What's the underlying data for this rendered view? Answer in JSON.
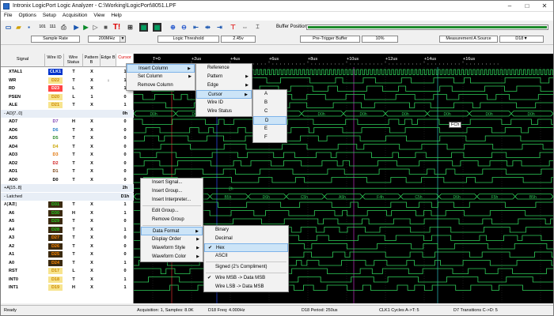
{
  "window": {
    "title": "Intronix LogicPort Logic Analyzer - C:\\Working\\LogicPort\\8051.LPF"
  },
  "menu": [
    "File",
    "Options",
    "Setup",
    "Acquisition",
    "View",
    "Help"
  ],
  "buffer": {
    "label": "Buffer Position:"
  },
  "toolbar2": {
    "sample_rate_label": "Sample Rate",
    "sample_rate": "200MHz",
    "threshold_label": "Logic Threshold",
    "threshold": "2.45v",
    "pretrigger_label": "Pre-Trigger Buffer",
    "pretrigger": "10%",
    "measurement_label": "Measurement A Source",
    "measurement": "D18"
  },
  "columns": {
    "signal": "Signal",
    "wire_id": "Wire ID",
    "wire_status": "Wire Status",
    "pattern": "Pattern B",
    "edge": "Edge B",
    "cursor": "Cursor"
  },
  "time_labels": [
    "T=0",
    "+2us",
    "+4us",
    "+6us",
    "+8us",
    "+10us",
    "+12us",
    "+14us",
    "+16us"
  ],
  "rows": [
    {
      "name": "XTAL1",
      "wire": "CLK1",
      "status": "T",
      "pattern": "X",
      "edge": "",
      "cursor": "1",
      "wcolor": "#0033cc",
      "tcolor": "#fff"
    },
    {
      "name": "WR",
      "wire": "D22",
      "status": "T",
      "pattern": "X",
      "edge": "↓",
      "cursor": "1",
      "wcolor": "#f7e48e",
      "tcolor": "#cc8800"
    },
    {
      "name": "RD",
      "wire": "D23",
      "status": "L",
      "pattern": "X",
      "edge": "",
      "cursor": "1",
      "wcolor": "#ff4444",
      "tcolor": "#ffffff"
    },
    {
      "name": "PSEN",
      "wire": "D20",
      "status": "L",
      "pattern": "1",
      "edge": "",
      "cursor": "0",
      "wcolor": "#f7e48e",
      "tcolor": "#cc8800"
    },
    {
      "name": "ALE",
      "wire": "D21",
      "status": "T",
      "pattern": "X",
      "edge": "",
      "cursor": "1",
      "wcolor": "#f7e48e",
      "tcolor": "#cc8800"
    },
    {
      "name": "- AD[7..0]",
      "wire": "",
      "status": "",
      "pattern": "",
      "edge": "",
      "cursor": "0h",
      "wcolor": "",
      "tcolor": ""
    },
    {
      "name": "AD7",
      "wire": "D7",
      "status": "H",
      "pattern": "X",
      "edge": "",
      "cursor": "0",
      "wcolor": "",
      "tcolor": "#7a3bb0"
    },
    {
      "name": "AD6",
      "wire": "D6",
      "status": "T",
      "pattern": "X",
      "edge": "",
      "cursor": "0",
      "wcolor": "",
      "tcolor": "#2a80c8"
    },
    {
      "name": "AD5",
      "wire": "D5",
      "status": "T",
      "pattern": "X",
      "edge": "",
      "cursor": "0",
      "wcolor": "",
      "tcolor": "#2a8a2a"
    },
    {
      "name": "AD4",
      "wire": "D4",
      "status": "T",
      "pattern": "X",
      "edge": "",
      "cursor": "0",
      "wcolor": "",
      "tcolor": "#c9a400"
    },
    {
      "name": "AD3",
      "wire": "D3",
      "status": "T",
      "pattern": "X",
      "edge": "",
      "cursor": "0",
      "wcolor": "",
      "tcolor": "#e07000"
    },
    {
      "name": "AD2",
      "wire": "D2",
      "status": "T",
      "pattern": "X",
      "edge": "",
      "cursor": "0",
      "wcolor": "",
      "tcolor": "#d02020"
    },
    {
      "name": "AD1",
      "wire": "D1",
      "status": "T",
      "pattern": "X",
      "edge": "",
      "cursor": "0",
      "wcolor": "",
      "tcolor": "#7a4010"
    },
    {
      "name": "AD0",
      "wire": "D0",
      "status": "T",
      "pattern": "X",
      "edge": "",
      "cursor": "0",
      "wcolor": "",
      "tcolor": "#000000"
    },
    {
      "name": "+A[15..8]",
      "wire": "",
      "status": "",
      "pattern": "",
      "edge": "",
      "cursor": "2h",
      "wcolor": "",
      "tcolor": ""
    },
    {
      "name": "- Latched A[7..0]",
      "wire": "",
      "status": "",
      "pattern": "",
      "edge": "",
      "cursor": "D1h",
      "wcolor": "",
      "tcolor": ""
    },
    {
      "name": "A7",
      "wire": "D31",
      "status": "T",
      "pattern": "X",
      "edge": "",
      "cursor": "1",
      "wcolor": "#3b2a10",
      "tcolor": "#22cc22"
    },
    {
      "name": "A6",
      "wire": "D30",
      "status": "H",
      "pattern": "X",
      "edge": "",
      "cursor": "1",
      "wcolor": "#3b2a10",
      "tcolor": "#22cc22"
    },
    {
      "name": "A5",
      "wire": "D29",
      "status": "T",
      "pattern": "X",
      "edge": "",
      "cursor": "0",
      "wcolor": "#3b2a10",
      "tcolor": "#22cc22"
    },
    {
      "name": "A4",
      "wire": "D28",
      "status": "T",
      "pattern": "X",
      "edge": "",
      "cursor": "1",
      "wcolor": "#3b2a10",
      "tcolor": "#22cc22"
    },
    {
      "name": "A3",
      "wire": "D27",
      "status": "T",
      "pattern": "X",
      "edge": "",
      "cursor": "0",
      "wcolor": "#3b2a10",
      "tcolor": "#ff8800"
    },
    {
      "name": "A2",
      "wire": "D26",
      "status": "T",
      "pattern": "X",
      "edge": "",
      "cursor": "0",
      "wcolor": "#3b2a10",
      "tcolor": "#ff8800"
    },
    {
      "name": "A1",
      "wire": "D25",
      "status": "T",
      "pattern": "X",
      "edge": "",
      "cursor": "0",
      "wcolor": "#3b2a10",
      "tcolor": "#ff8800"
    },
    {
      "name": "A0",
      "wire": "D24",
      "status": "T",
      "pattern": "X",
      "edge": "",
      "cursor": "1",
      "wcolor": "#3b2a10",
      "tcolor": "#ff8800"
    },
    {
      "name": "RST",
      "wire": "D17",
      "status": "L",
      "pattern": "X",
      "edge": "",
      "cursor": "0",
      "wcolor": "#f7e48e",
      "tcolor": "#cc8800"
    },
    {
      "name": "INT0",
      "wire": "D18",
      "status": "T",
      "pattern": "X",
      "edge": "",
      "cursor": "1",
      "wcolor": "#f7e48e",
      "tcolor": "#cc8800"
    },
    {
      "name": "INT1",
      "wire": "D19",
      "status": "H",
      "pattern": "X",
      "edge": "",
      "cursor": "1",
      "wcolor": "#f7e48e",
      "tcolor": "#cc8800"
    }
  ],
  "hdr_menu": {
    "items": [
      "Insert Column",
      "Set Column",
      "Remove Column"
    ]
  },
  "column_submenu": {
    "items": [
      "Reference",
      "Pattern",
      "Edge",
      "Cursor",
      "Wire ID",
      "Wire Status"
    ]
  },
  "cursor_submenu": {
    "items": [
      "A",
      "B",
      "C",
      "D",
      "E",
      "F"
    ]
  },
  "signal_menu": {
    "items": [
      "Insert Signal...",
      "Insert Group...",
      "Insert Interpreter...",
      "Edit Group...",
      "Remove Group",
      "Data Format",
      "Display Order",
      "Waveform Style",
      "Waveform Color"
    ]
  },
  "format_submenu": {
    "items": [
      "Binary",
      "Decimal",
      "Hex",
      "ASCII",
      "Signed (2's Compliment)",
      "Wire MSB -> Data MSB",
      "Wire LSB -> Data MSB"
    ]
  },
  "status": {
    "ready": "Ready",
    "acq": "Acquisition: 1, Samples: 8.0K",
    "freq": "D18 Freq: 4.000Hz",
    "period": "D18 Period: 250us",
    "clk": "CLK1 Cycles A->T: 5",
    "trans": "D7 Transitions C->D: 5"
  },
  "bus_labels": {
    "ad": [
      "D0h",
      "D0h",
      "D0h",
      "D0h",
      "D0h",
      "D0h",
      "D0h",
      "D0h",
      "D0h",
      "D0h"
    ],
    "latched": [
      "CBh",
      "C0h",
      "B5h",
      "D6h",
      "C5h",
      "A5h",
      "F4h",
      "C5h",
      "D6h",
      "F5h",
      "B5h"
    ],
    "a15": "2h"
  },
  "tooltip": "FCh"
}
